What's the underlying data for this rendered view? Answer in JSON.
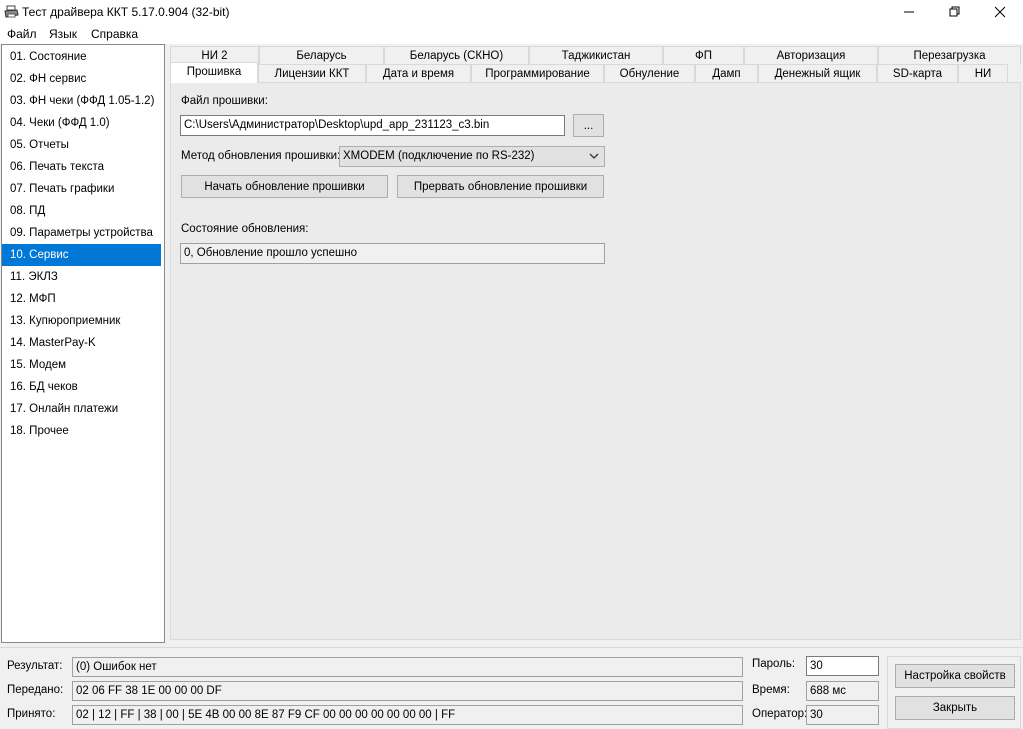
{
  "window": {
    "title": "Тест драйвера ККТ 5.17.0.904 (32-bit)",
    "controls": {
      "minimize": "—",
      "maximize": "❐",
      "close": "✕"
    }
  },
  "menu": [
    "Файл",
    "Язык",
    "Справка"
  ],
  "sidebar": {
    "items": [
      "01. Состояние",
      "02. ФН сервис",
      "03. ФН чеки (ФФД 1.05-1.2)",
      "04. Чеки (ФФД 1.0)",
      "05. Отчеты",
      "06. Печать текста",
      "07. Печать графики",
      "08. ПД",
      "09. Параметры устройства",
      "10. Сервис",
      "11. ЭКЛЗ",
      "12. МФП",
      "13. Купюроприемник",
      "14. MasterPay-K",
      "15. Модем",
      "16. БД чеков",
      "17. Онлайн платежи",
      "18. Прочее"
    ],
    "selected_index": 9
  },
  "tabs": {
    "row1": [
      "НИ 2",
      "Беларусь",
      "Беларусь (СКНО)",
      "Таджикистан",
      "ФП",
      "Авторизация",
      "Перезагрузка"
    ],
    "row2": [
      "Прошивка",
      "Лицензии ККТ",
      "Дата и время",
      "Программирование",
      "Обнуление",
      "Дамп",
      "Денежный ящик",
      "SD-карта",
      "НИ"
    ],
    "active": "Прошивка"
  },
  "firmware": {
    "file_label": "Файл прошивки:",
    "file_value": "C:\\Users\\Администратор\\Desktop\\upd_app_231123_c3.bin",
    "browse_label": "...",
    "method_label": "Метод обновления прошивки:",
    "method_value": "XMODEM (подключение по RS-232)",
    "start_button": "Начать обновление прошивки",
    "abort_button": "Прервать обновление прошивки",
    "status_label": "Состояние обновления:",
    "status_value": "0, Обновление прошло успешно"
  },
  "bottom": {
    "result_label": "Результат:",
    "result_value": "(0) Ошибок нет",
    "sent_label": "Передано:",
    "sent_value": "02 06 FF 38 1E 00 00 00 DF",
    "received_label": "Принято:",
    "received_value": "02 | 12 | FF | 38 | 00 | 5E 4B 00 00 8E 87 F9 CF 00 00 00 00 00 00 00 | FF",
    "password_label": "Пароль:",
    "password_value": "30",
    "time_label": "Время:",
    "time_value": "688 мс",
    "operator_label": "Оператор:",
    "operator_value": "30",
    "settings_button": "Настройка свойств",
    "close_button": "Закрыть"
  },
  "colors": {
    "selection": "#0078d7",
    "window_bg": "#f0f0f0",
    "panel_bg": "#ebebeb"
  }
}
